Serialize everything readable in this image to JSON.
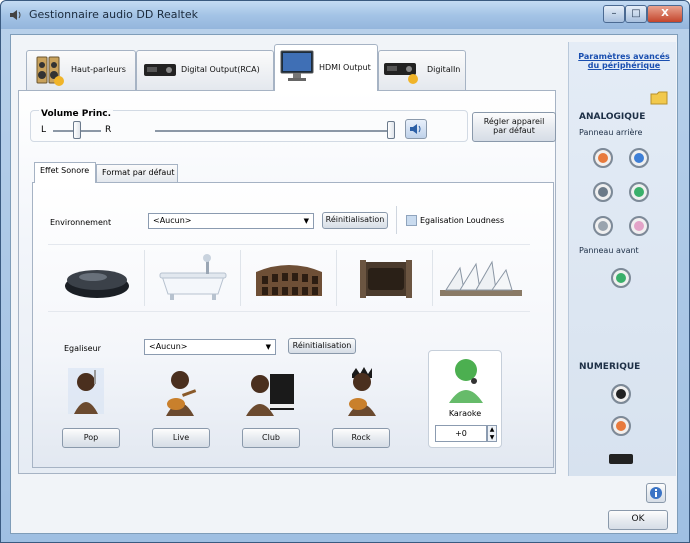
{
  "window": {
    "title": "Gestionnaire audio DD Realtek"
  },
  "device_tabs": [
    {
      "label": "Haut-parleurs",
      "icon": "speakers-icon"
    },
    {
      "label": "Digital Output(RCA)",
      "icon": "digital-out-icon"
    },
    {
      "label": "HDMI Output",
      "icon": "monitor-icon",
      "active": true
    },
    {
      "label": "DigitalIn",
      "icon": "digital-in-icon"
    }
  ],
  "volume": {
    "title": "Volume Princ.",
    "left_label": "L",
    "right_label": "R",
    "balance": 0.5,
    "level": 1.0,
    "set_default_label": "Régler appareil par défaut"
  },
  "sub_tabs": [
    {
      "label": "Effet Sonore",
      "active": true
    },
    {
      "label": "Format par défaut"
    }
  ],
  "environment": {
    "label": "Environnement",
    "value": "<Aucun>",
    "reset_label": "Réinitialisation",
    "loudness_label": "Egalisation Loudness",
    "loudness_checked": false,
    "presets": [
      "stone-icon",
      "bathtub-icon",
      "colosseum-icon",
      "pipe-icon",
      "opera-house-icon"
    ]
  },
  "equalizer": {
    "label": "Egaliseur",
    "value": "<Aucun>",
    "reset_label": "Réinitialisation",
    "presets": [
      "Pop",
      "Live",
      "Club",
      "Rock"
    ]
  },
  "karaoke": {
    "label": "Karaoke",
    "value": "+0"
  },
  "right_panel": {
    "advanced_link": "Paramètres avancés du périphérique",
    "analog_title": "ANALOGIQUE",
    "rear_panel": "Panneau arrière",
    "front_panel": "Panneau avant",
    "digital_title": "NUMERIQUE",
    "rear_jacks": [
      "#e87a3c",
      "#3e7fd6",
      "#6c7a88",
      "#3ab06a",
      "#9aa4ae",
      "#e3a3c8"
    ],
    "front_jacks": [
      "#3ab06a"
    ],
    "digital_jacks": [
      "#222222",
      "#e87a3c"
    ]
  },
  "footer": {
    "ok_label": "OK",
    "info_icon": "info-icon"
  }
}
